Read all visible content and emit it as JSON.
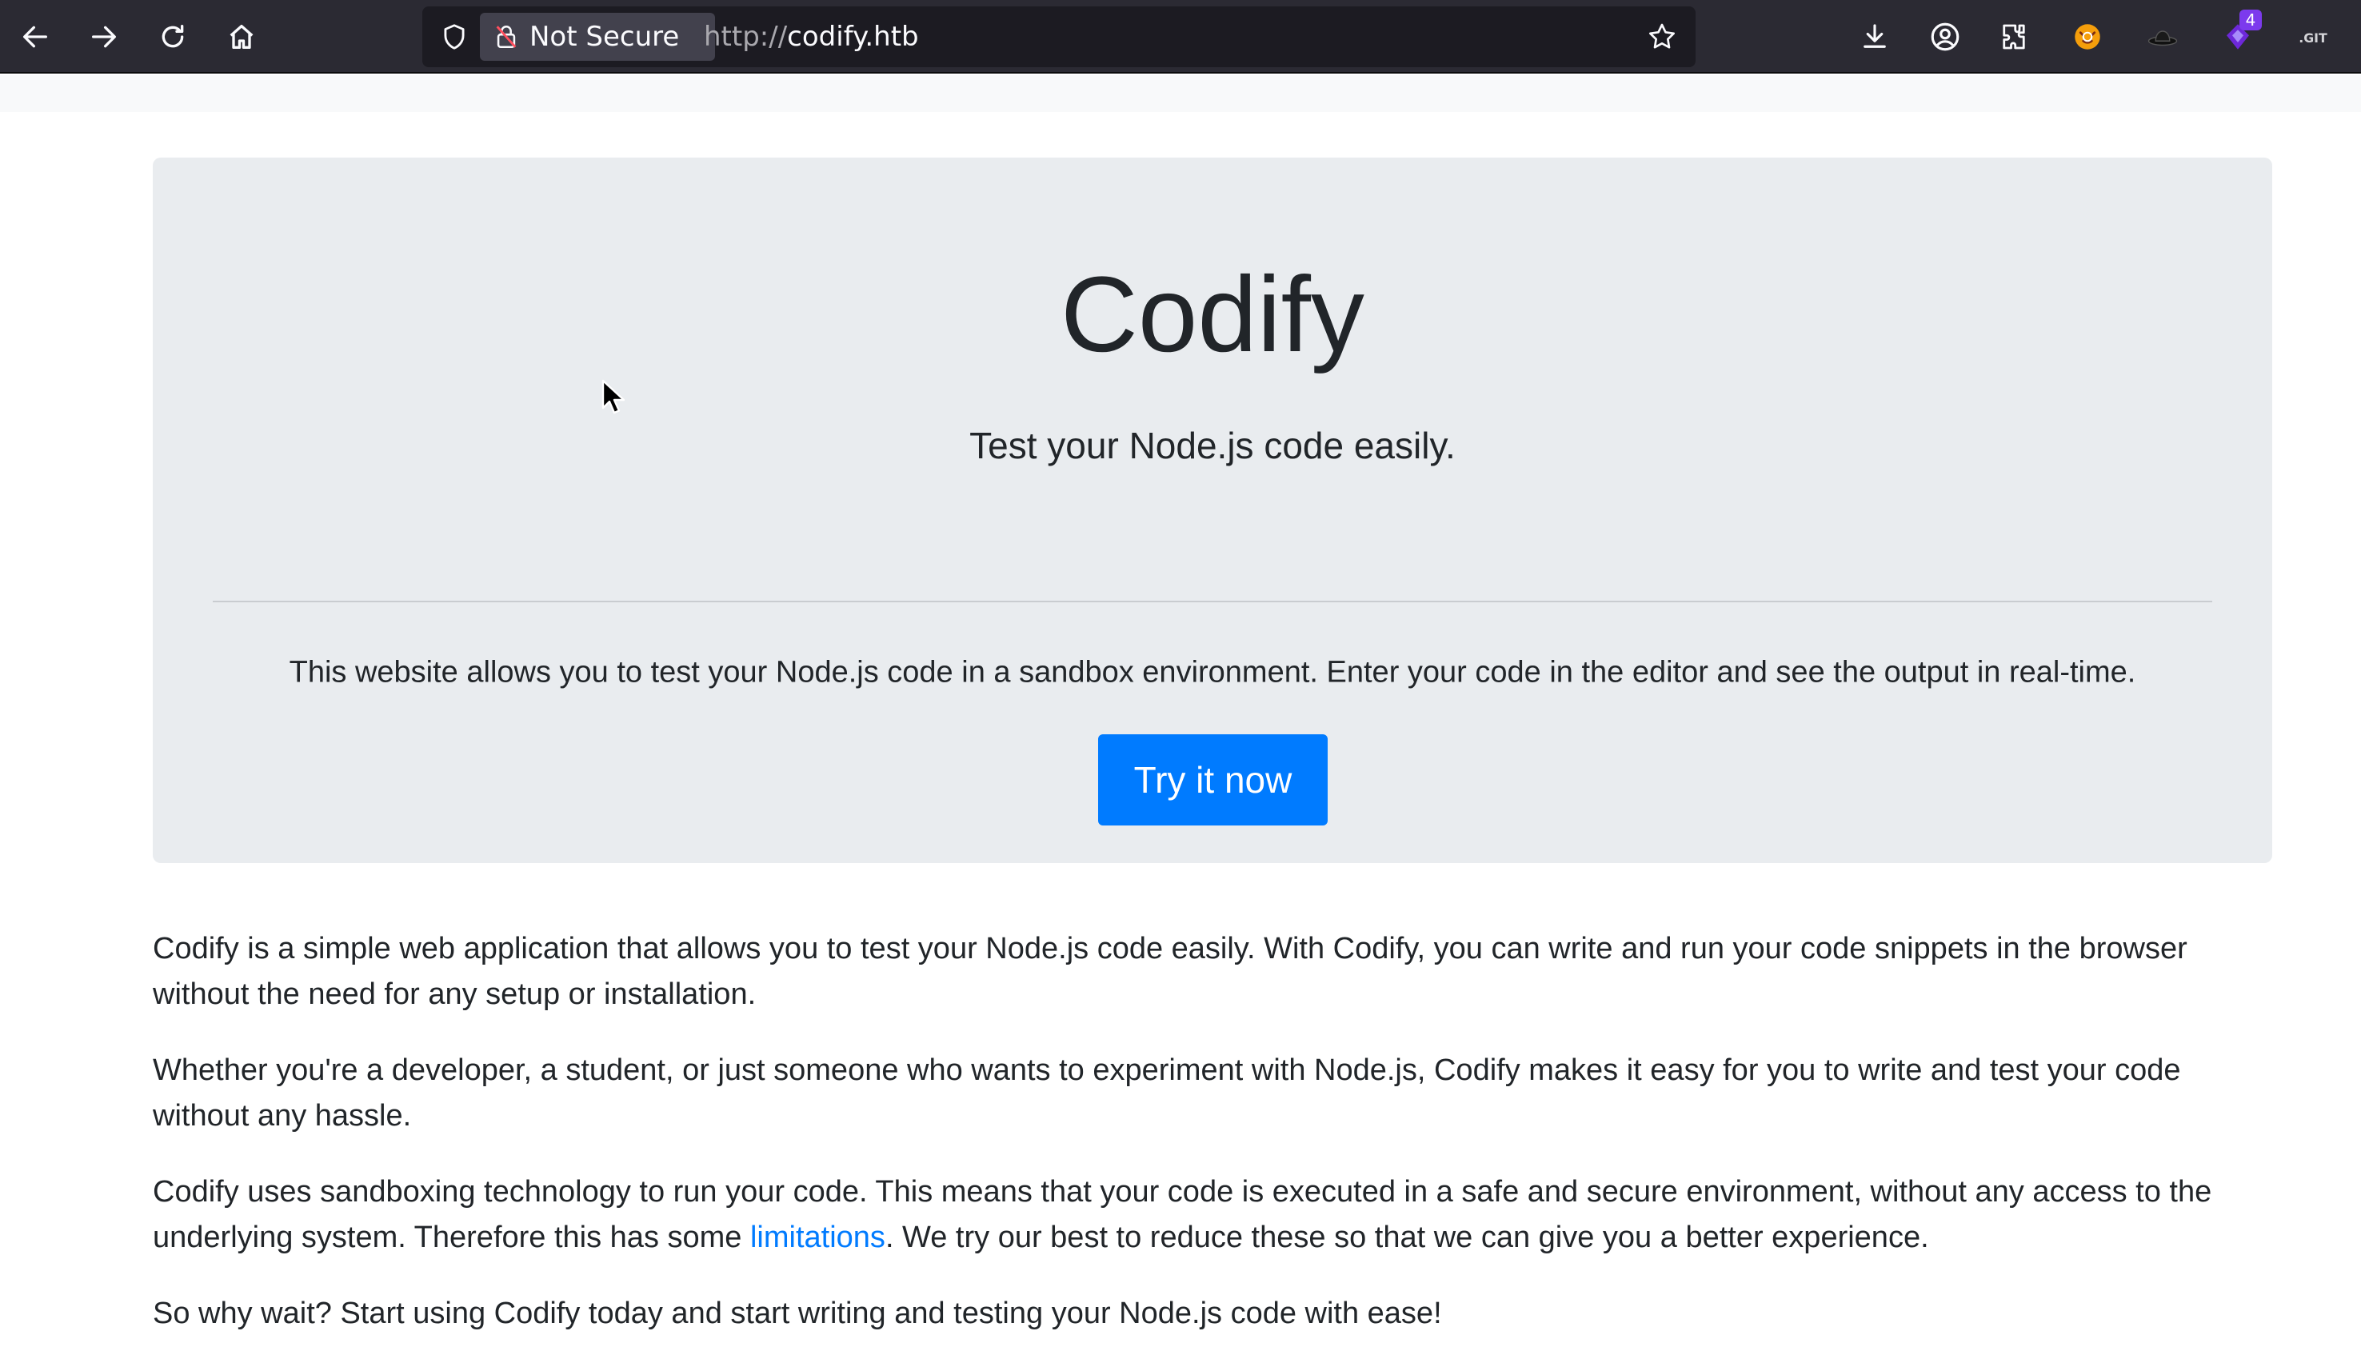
{
  "browser": {
    "security_label": "Not Secure",
    "url_scheme": "http://",
    "url_host": "codify.htb",
    "extension_badge": "4",
    "icons": [
      "back-icon",
      "forward-icon",
      "reload-icon",
      "home-icon",
      "shield-icon",
      "lock-icon",
      "star-icon",
      "download-icon",
      "account-icon",
      "extensions-icon",
      "fox-extension-icon",
      "hat-extension-icon",
      "purple-extension-icon",
      "git-extension-icon"
    ]
  },
  "jumbotron": {
    "title": "Codify",
    "lead": "Test your Node.js code easily.",
    "description": "This website allows you to test your Node.js code in a sandbox environment. Enter your code in the editor and see the output in real-time.",
    "cta_label": "Try it now"
  },
  "content": {
    "p1": "Codify is a simple web application that allows you to test your Node.js code easily. With Codify, you can write and run your code snippets in the browser without the need for any setup or installation.",
    "p2": "Whether you're a developer, a student, or just someone who wants to experiment with Node.js, Codify makes it easy for you to write and test your code without any hassle.",
    "p3_before": "Codify uses sandboxing technology to run your code. This means that your code is executed in a safe and secure environment, without any access to the underlying system. Therefore this has some ",
    "p3_link": "limitations",
    "p3_after": ". We try our best to reduce these so that we can give you a better experience.",
    "p4": "So why wait? Start using Codify today and start writing and testing your Node.js code with ease!"
  },
  "colors": {
    "toolbar_bg": "#2b2a33",
    "jumbotron_bg": "#e9ecef",
    "primary": "#007bff",
    "text": "#212529"
  }
}
